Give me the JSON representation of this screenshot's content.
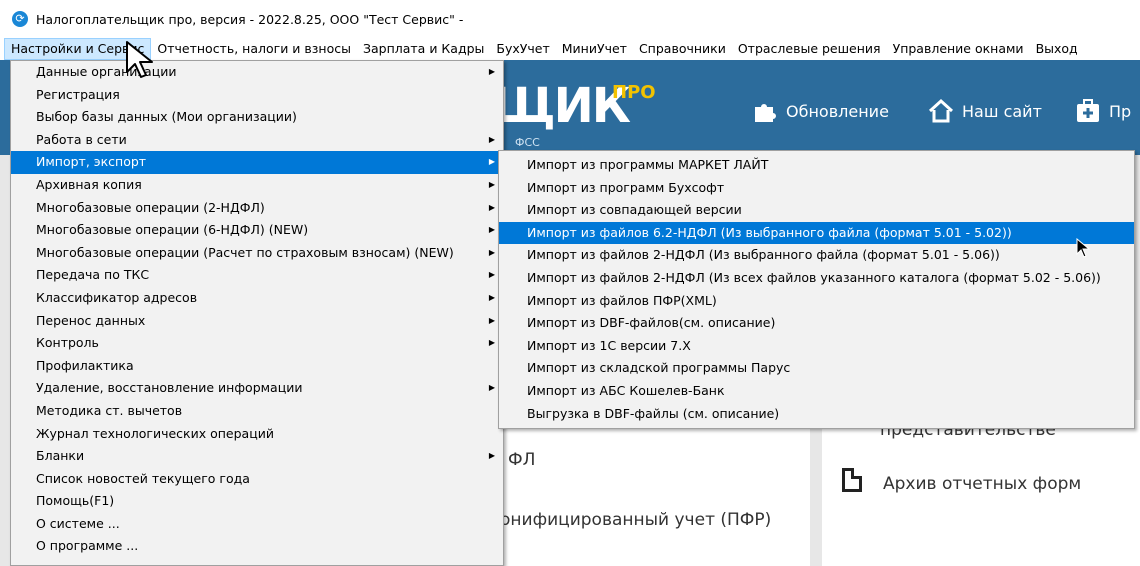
{
  "window": {
    "title": "Налогоплательщик про, версия - 2022.8.25, ООО  \"Тест Сервис\"  -",
    "icon": "refresh-icon"
  },
  "menubar": [
    {
      "label": "Настройки и Сервис",
      "active": true
    },
    {
      "label": "Отчетность, налоги и взносы"
    },
    {
      "label": "Зарплата и Кадры"
    },
    {
      "label": "БухУчет"
    },
    {
      "label": "МиниУчет"
    },
    {
      "label": "Справочники"
    },
    {
      "label": "Отраслевые решения"
    },
    {
      "label": "Управление окнами"
    },
    {
      "label": "Выход"
    }
  ],
  "background": {
    "logo": "ЩИК",
    "logo_pro": "ПРО",
    "logo_sub": "ФСС",
    "update_button": "Обновление",
    "site_button": "Наш сайт",
    "third_button": "Пр",
    "text_predstav": "представительстве",
    "text_archive": "Архив отчетных форм",
    "text_fl": "ФЛ",
    "text_pfr": "онифицированный учет (ПФР)"
  },
  "main_menu": [
    {
      "label": "Данные организации",
      "submenu": true
    },
    {
      "label": "Регистрация"
    },
    {
      "label": "Выбор базы данных (Мои организации)"
    },
    {
      "label": "Работа в сети",
      "submenu": true
    },
    {
      "label": "Импорт, экспорт",
      "submenu": true,
      "highlighted": true
    },
    {
      "label": "Архивная копия",
      "submenu": true
    },
    {
      "label": "Многобазовые операции (2-НДФЛ)",
      "submenu": true
    },
    {
      "label": "Многобазовые операции (6-НДФЛ) (NEW)",
      "submenu": true
    },
    {
      "label": "Многобазовые операции (Расчет по страховым взносам) (NEW)",
      "submenu": true
    },
    {
      "label": "Передача по ТКС",
      "submenu": true
    },
    {
      "label": "Классификатор адресов",
      "submenu": true
    },
    {
      "label": "Перенос данных",
      "submenu": true
    },
    {
      "label": "Контроль",
      "submenu": true
    },
    {
      "label": "Профилактика"
    },
    {
      "label": "Удаление, восстановление информации",
      "submenu": true
    },
    {
      "label": "Методика ст. вычетов"
    },
    {
      "label": "Журнал технологических операций"
    },
    {
      "label": "Бланки",
      "submenu": true
    },
    {
      "label": "Список новостей текущего года"
    },
    {
      "label": "Помощь(F1)"
    },
    {
      "label": "О системе ..."
    },
    {
      "label": "О программе ..."
    }
  ],
  "sub_menu": [
    {
      "label": "Импорт из программы МАРКЕТ ЛАЙТ"
    },
    {
      "label": "Импорт из программ Бухсофт"
    },
    {
      "label": "Импорт из совпадающей версии"
    },
    {
      "label": "Импорт из файлов 6.2-НДФЛ (Из выбранного файла (формат 5.01 - 5.02))",
      "highlighted": true
    },
    {
      "label": "Импорт из файлов 2-НДФЛ (Из выбранного файла (формат 5.01 - 5.06))"
    },
    {
      "label": "Импорт из файлов 2-НДФЛ (Из всех файлов указанного каталога (формат 5.02 - 5.06))"
    },
    {
      "label": "Импорт из файлов ПФР(XML)"
    },
    {
      "label": "Импорт из DBF-файлов(см. описание)"
    },
    {
      "label": "Импорт из 1С версии 7.Х"
    },
    {
      "label": "Импорт из складской программы Парус"
    },
    {
      "label": "Импорт из АБС Кошелев-Банк"
    },
    {
      "label": "Выгрузка в DBF-файлы (см. описание)"
    }
  ],
  "colors": {
    "highlight": "#0078d7",
    "banner": "#2c6c9c",
    "menu_bg": "#f2f2f2"
  }
}
